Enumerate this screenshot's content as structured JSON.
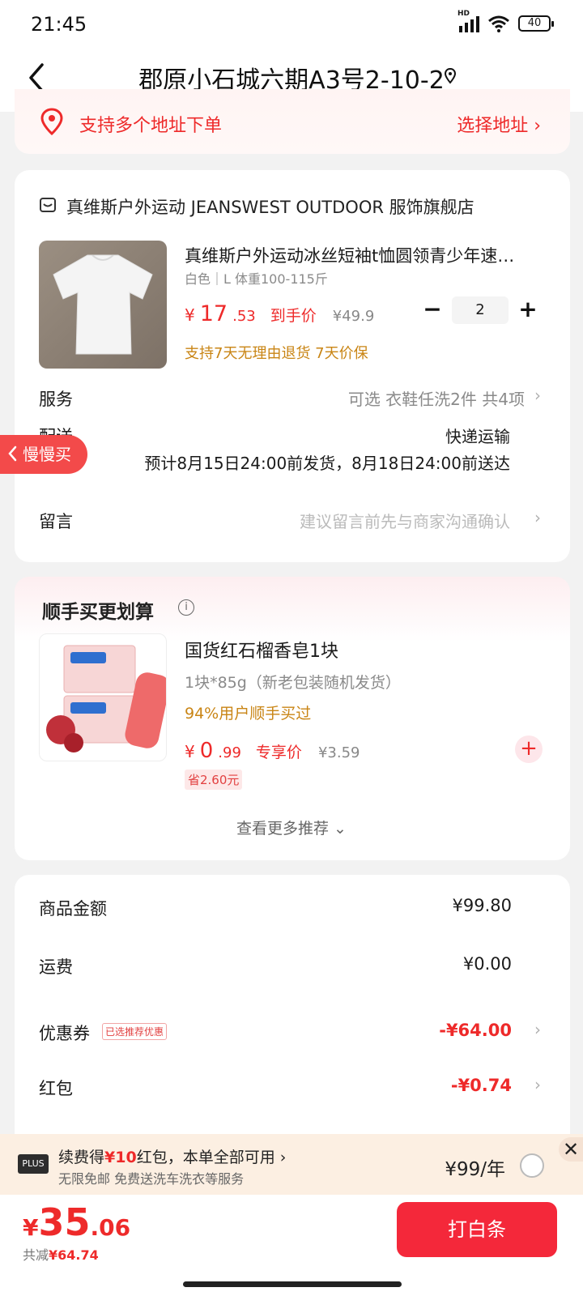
{
  "status_bar": {
    "time": "21:45",
    "network_badge": "HD",
    "battery": "40"
  },
  "header": {
    "title": "郡原小石城六期A3号2-10-2"
  },
  "multi_address": {
    "text": "支持多个地址下单",
    "action": "选择地址 ›"
  },
  "shop": {
    "name": "真维斯户外运动 JEANSWEST OUTDOOR 服饰旗舰店"
  },
  "product": {
    "title": "真维斯户外运动冰丝短袖t恤圆领青少年速…",
    "spec": "白色｜L 体重100-115斤",
    "price_currency": "¥",
    "price_int": "17",
    "price_dec": ".53",
    "price_label": "到手价",
    "orig_price": "¥49.9",
    "quantity": "2",
    "qty_minus": "−",
    "qty_plus": "+",
    "policy": "支持7天无理由退货 7天价保"
  },
  "rows": {
    "service_label": "服务",
    "service_value": "可选 衣鞋任洗2件 共4项",
    "delivery_label": "配送",
    "delivery_method": "快递运输",
    "delivery_time": "预计8月15日24:00前发货，8月18日24:00前送达",
    "remark_label": "留言",
    "remark_value": "建议留言前先与商家沟通确认",
    "chevron": "›"
  },
  "slow_buy": {
    "label": "慢慢买"
  },
  "addon": {
    "title": "顺手买更划算",
    "info": "i",
    "name": "国货红石榴香皂1块",
    "spec": "1块*85g（新老包装随机发货）",
    "buy_rate": "94%用户顺手买过",
    "price_currency": "¥",
    "price_int": "0",
    "price_dec": ".99",
    "price_label": "专享价",
    "orig_price": "¥3.59",
    "save": "省2.60元",
    "add": "+",
    "see_more": "查看更多推荐 ⌄"
  },
  "summary": {
    "goods_label": "商品金额",
    "goods_value": "¥99.80",
    "shipping_label": "运费",
    "shipping_value": "¥0.00",
    "coupon_label": "优惠券",
    "coupon_tag": "已选推荐优惠",
    "coupon_value": "-¥64.00",
    "redpacket_label": "红包",
    "redpacket_value": "-¥0.74"
  },
  "plus": {
    "badge": "PLUS",
    "main_prefix": "续费得",
    "main_highlight": "¥10",
    "main_suffix": "红包，本单全部可用 ›",
    "sub": "无限免邮 免费送洗车洗衣等服务",
    "price": "¥99/年",
    "close": "✕"
  },
  "bottom": {
    "currency": "¥",
    "total_int": "35",
    "total_dec": ".06",
    "saved_label": "共减",
    "saved_value": "¥64.74",
    "checkout": "打白条"
  },
  "colors": {
    "accent": "#ee2a2a",
    "checkout": "#f4283a",
    "gold": "#c98515"
  }
}
